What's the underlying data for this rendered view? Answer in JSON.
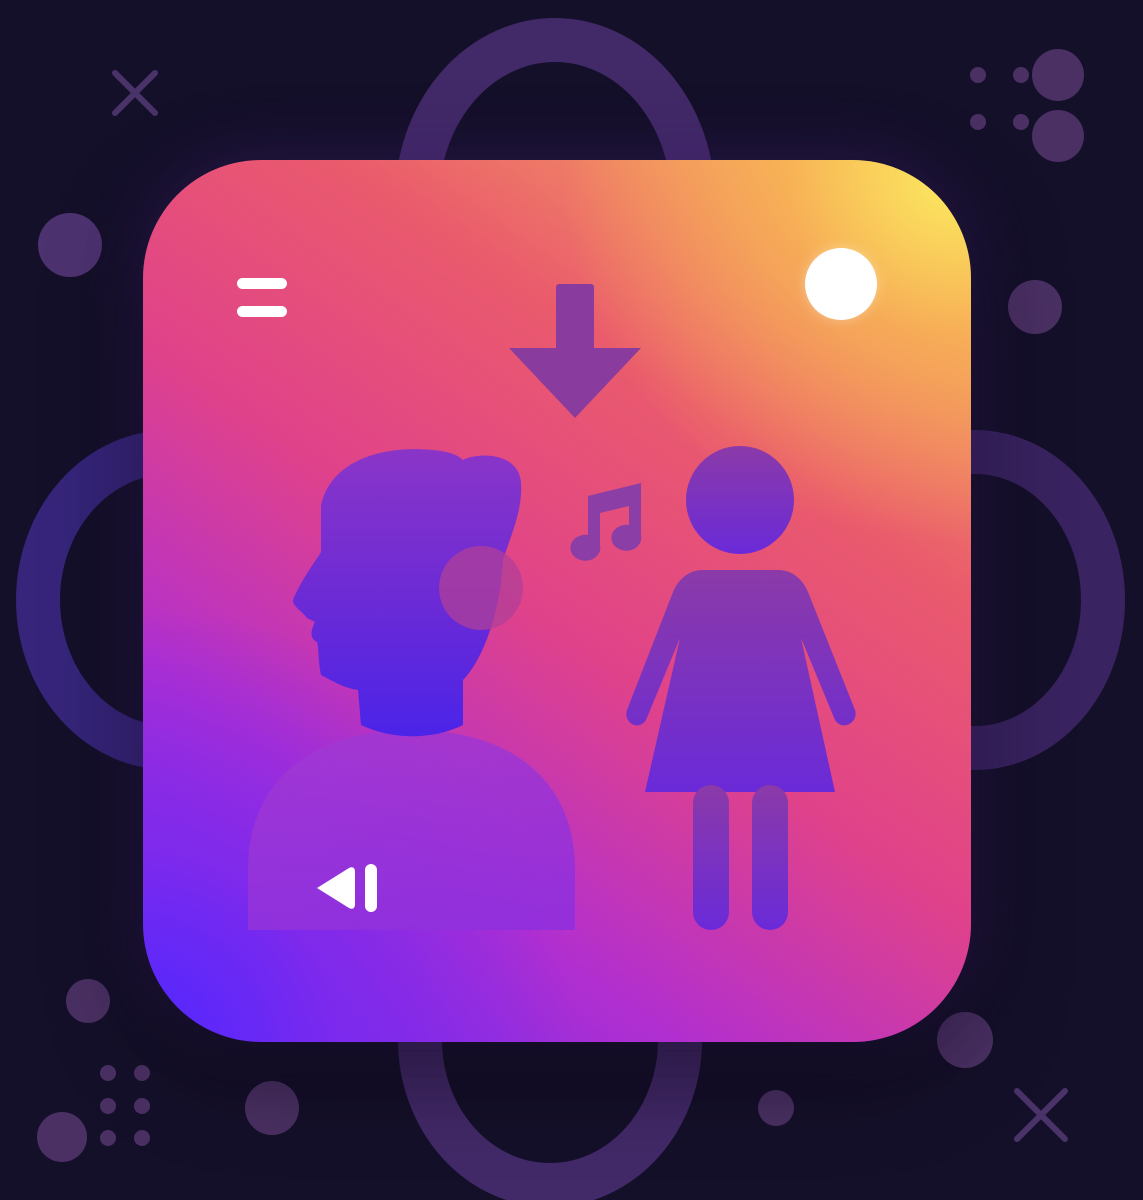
{
  "colors": {
    "background": "#15102a",
    "card_gradient": [
      "#fbe05e",
      "#ea5b6c",
      "#e0428a",
      "#b22fcf",
      "#5a2cff"
    ],
    "figure_fill": "#6d2bd6",
    "arrow_fill": "#7f3aa6",
    "accent_white": "#ffffff"
  },
  "icons": {
    "menu": "menu-icon",
    "download_arrow": "arrow-down-icon",
    "music_note": "music-note-icon",
    "man": "man-listening-icon",
    "woman": "woman-icon",
    "status": "status-dot",
    "playback": "skip-back-icon"
  }
}
